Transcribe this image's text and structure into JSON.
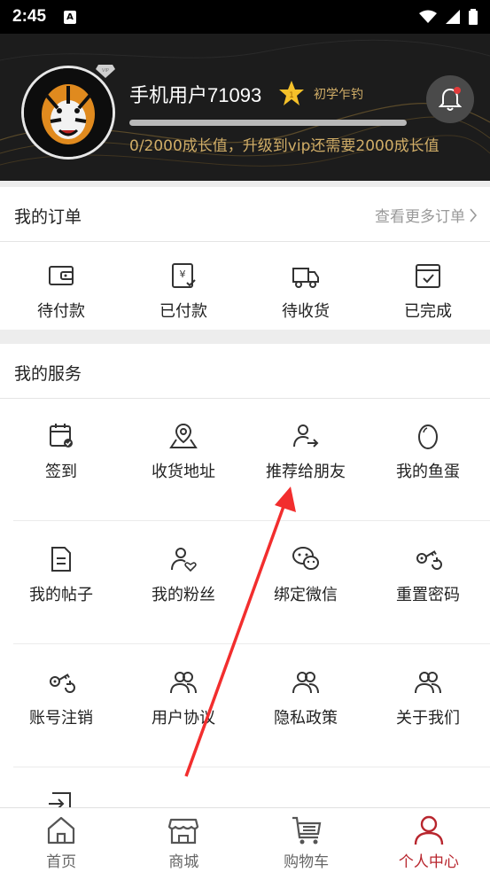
{
  "status_bar": {
    "time": "2:45"
  },
  "header": {
    "username": "手机用户71093",
    "level_number": "1",
    "level": "初学乍钓",
    "growth_progress": 0,
    "growth_text": "0/2000成长值，升级到vip还需要2000成长值"
  },
  "orders": {
    "title": "我的订单",
    "more": "查看更多订单",
    "items": [
      {
        "label": "待付款",
        "icon": "wallet-icon"
      },
      {
        "label": "已付款",
        "icon": "paid-receipt-icon"
      },
      {
        "label": "待收货",
        "icon": "delivery-truck-icon"
      },
      {
        "label": "已完成",
        "icon": "completed-calendar-icon"
      }
    ]
  },
  "services": {
    "title": "我的服务",
    "items": [
      {
        "label": "签到",
        "icon": "checkin-calendar-icon"
      },
      {
        "label": "收货地址",
        "icon": "location-map-icon"
      },
      {
        "label": "推荐给朋友",
        "icon": "share-user-icon"
      },
      {
        "label": "我的鱼蛋",
        "icon": "egg-icon"
      },
      {
        "label": "我的帖子",
        "icon": "document-icon"
      },
      {
        "label": "我的粉丝",
        "icon": "fans-heart-icon"
      },
      {
        "label": "绑定微信",
        "icon": "wechat-icon"
      },
      {
        "label": "重置密码",
        "icon": "key-reset-icon"
      },
      {
        "label": "账号注销",
        "icon": "key-cancel-icon"
      },
      {
        "label": "用户协议",
        "icon": "users-group-icon"
      },
      {
        "label": "隐私政策",
        "icon": "users-group-icon"
      },
      {
        "label": "关于我们",
        "icon": "users-group-icon"
      }
    ]
  },
  "bottom_nav": [
    {
      "label": "首页",
      "icon": "home-icon"
    },
    {
      "label": "商城",
      "icon": "store-icon"
    },
    {
      "label": "购物车",
      "icon": "cart-icon"
    },
    {
      "label": "个人中心",
      "icon": "person-icon",
      "active": true
    }
  ],
  "colors": {
    "accent_gold": "#d0ad67",
    "active_red": "#b8262e",
    "annotation_arrow": "#f22e2e",
    "header_bg": "#1c1c1c"
  }
}
